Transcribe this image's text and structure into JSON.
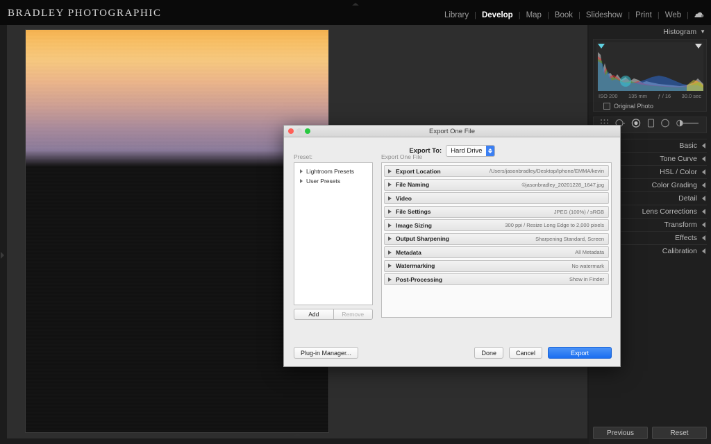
{
  "app": {
    "brand": "BRADLEY PHOTOGRAPHIC",
    "modules": [
      {
        "label": "Library",
        "active": false
      },
      {
        "label": "Develop",
        "active": true
      },
      {
        "label": "Map",
        "active": false
      },
      {
        "label": "Book",
        "active": false
      },
      {
        "label": "Slideshow",
        "active": false
      },
      {
        "label": "Print",
        "active": false
      },
      {
        "label": "Web",
        "active": false
      }
    ],
    "separator": "|",
    "cloud_icon": "cloud-icon"
  },
  "right_panel": {
    "histogram_title": "Histogram",
    "histogram_caret": "▼",
    "exif": {
      "iso": "ISO 200",
      "focal": "135 mm",
      "aperture": "ƒ / 16",
      "shutter": "30.0 sec"
    },
    "original_photo_label": "Original Photo",
    "tools": [
      "crop-overlay-icon",
      "spot-removal-icon",
      "red-eye-icon",
      "graduated-filter-icon",
      "radial-filter-icon",
      "adjustment-brush-icon"
    ],
    "sections": [
      {
        "label": "Basic"
      },
      {
        "label": "Tone Curve"
      },
      {
        "label": "HSL / Color"
      },
      {
        "label": "Color Grading"
      },
      {
        "label": "Detail"
      },
      {
        "label": "Lens Corrections"
      },
      {
        "label": "Transform"
      },
      {
        "label": "Effects"
      },
      {
        "label": "Calibration"
      }
    ],
    "previous_label": "Previous",
    "reset_label": "Reset"
  },
  "dialog": {
    "title": "Export One File",
    "export_to_label": "Export To:",
    "export_to_value": "Hard Drive",
    "preset_label": "Preset:",
    "presets": [
      {
        "label": "Lightroom Presets"
      },
      {
        "label": "User Presets"
      }
    ],
    "add_label": "Add",
    "remove_label": "Remove",
    "sections_label": "Export One File",
    "sections": [
      {
        "name": "Export Location",
        "value": "/Users/jasonbradley/Desktop/Iphone/EMMA/kevin"
      },
      {
        "name": "File Naming",
        "value": "©jasonbradley_20201228_1647.jpg"
      },
      {
        "name": "Video",
        "value": ""
      },
      {
        "name": "File Settings",
        "value": "JPEG (100%) / sRGB"
      },
      {
        "name": "Image Sizing",
        "value": "300 ppi / Resize Long Edge to 2,000 pixels"
      },
      {
        "name": "Output Sharpening",
        "value": "Sharpening Standard, Screen"
      },
      {
        "name": "Metadata",
        "value": "All Metadata"
      },
      {
        "name": "Watermarking",
        "value": "No watermark"
      },
      {
        "name": "Post-Processing",
        "value": "Show in Finder"
      }
    ],
    "plugin_manager_label": "Plug-in Manager...",
    "done_label": "Done",
    "cancel_label": "Cancel",
    "export_label": "Export"
  },
  "colors": {
    "accent_blue": "#1a6ef0",
    "panel_bg": "#1f1f1f",
    "stage_bg": "#2e2e2e",
    "dialog_bg": "#ececec"
  }
}
